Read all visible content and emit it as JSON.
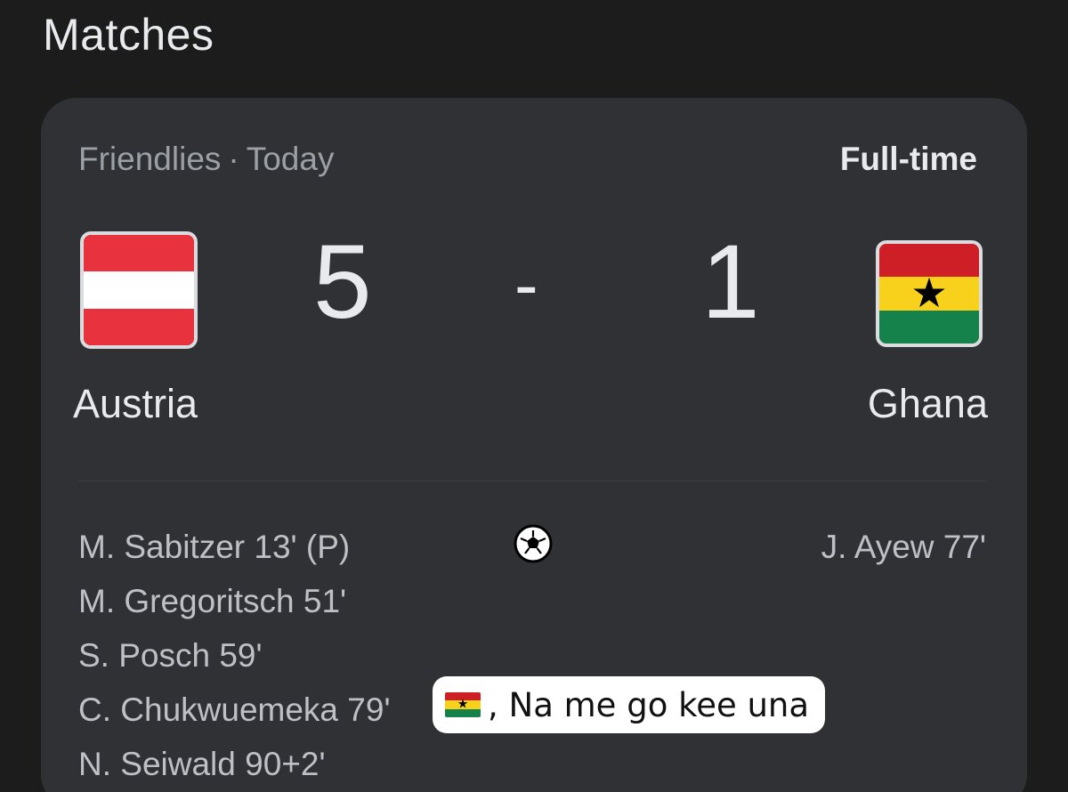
{
  "page": {
    "title": "Matches"
  },
  "match": {
    "competition": "Friendlies",
    "separator": "·",
    "day": "Today",
    "status": "Full-time",
    "score_separator": "-",
    "home": {
      "name": "Austria",
      "score": "5",
      "flag_colors": [
        "#e8323d",
        "#ffffff",
        "#e8323d"
      ],
      "scorers": [
        "M. Sabitzer 13' (P)",
        "M. Gregoritsch 51'",
        "S. Posch 59'",
        "C. Chukwuemeka 79'",
        "N. Seiwald 90+2'"
      ]
    },
    "away": {
      "name": "Ghana",
      "score": "1",
      "flag_colors": [
        "#ce1f26",
        "#f7d11b",
        "#14824a"
      ],
      "flag_icon": "black-star",
      "scorers": [
        "J. Ayew 77'"
      ]
    },
    "goals_icon": "soccer-ball-icon"
  },
  "overlay": {
    "flag_emoji_colors": [
      "#ce1f26",
      "#f7d11b",
      "#14824a"
    ],
    "text": ", Na me go kee una"
  }
}
